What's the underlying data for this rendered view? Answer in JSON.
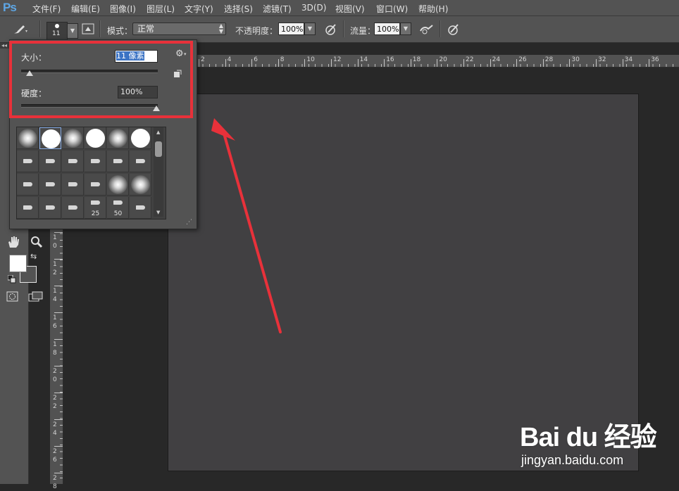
{
  "menubar": {
    "logo": "Ps",
    "items": [
      "文件(F)",
      "编辑(E)",
      "图像(I)",
      "图层(L)",
      "文字(Y)",
      "选择(S)",
      "滤镜(T)",
      "3D(D)",
      "视图(V)",
      "窗口(W)",
      "帮助(H)"
    ]
  },
  "options": {
    "brush_size_preview": "11",
    "mode_label": "模式：",
    "mode_value": "正常",
    "opacity_label": "不透明度：",
    "opacity_value": "100%",
    "flow_label": "流量：",
    "flow_value": "100%"
  },
  "brush_panel": {
    "size_label": "大小：",
    "size_value": "11 像素",
    "size_slider_value": 0.05,
    "hardness_label": "硬度：",
    "hardness_value": "100%",
    "hardness_slider_value": 1.0,
    "presets": [
      {
        "kind": "soft",
        "label": ""
      },
      {
        "kind": "hard",
        "label": ""
      },
      {
        "kind": "soft",
        "label": ""
      },
      {
        "kind": "hard",
        "label": ""
      },
      {
        "kind": "soft",
        "label": ""
      },
      {
        "kind": "hard",
        "label": ""
      },
      {
        "kind": "tip",
        "label": ""
      },
      {
        "kind": "tip",
        "label": ""
      },
      {
        "kind": "tip",
        "label": ""
      },
      {
        "kind": "tip",
        "label": ""
      },
      {
        "kind": "tip",
        "label": ""
      },
      {
        "kind": "tip",
        "label": ""
      },
      {
        "kind": "tip",
        "label": ""
      },
      {
        "kind": "tip",
        "label": ""
      },
      {
        "kind": "tip",
        "label": ""
      },
      {
        "kind": "tip",
        "label": ""
      },
      {
        "kind": "soft",
        "label": ""
      },
      {
        "kind": "soft",
        "label": ""
      },
      {
        "kind": "tip",
        "label": ""
      },
      {
        "kind": "tip",
        "label": ""
      },
      {
        "kind": "tip",
        "label": ""
      },
      {
        "kind": "tip",
        "label": "25"
      },
      {
        "kind": "tip",
        "label": "50"
      },
      {
        "kind": "tip",
        "label": ""
      }
    ]
  },
  "rulers": {
    "horizontal": [
      "2",
      "4",
      "6",
      "8",
      "10",
      "12",
      "14",
      "16",
      "18",
      "20",
      "22",
      "24",
      "26",
      "28",
      "30",
      "32",
      "34",
      "36"
    ],
    "vertical": [
      "10",
      "12",
      "14",
      "16",
      "18",
      "20",
      "22",
      "24",
      "26",
      "28"
    ]
  },
  "watermark": {
    "logo": "Bai du 经验",
    "url": "jingyan.baidu.com"
  },
  "colors": {
    "highlight": "#e8313a",
    "accent": "#5ea6e4"
  }
}
